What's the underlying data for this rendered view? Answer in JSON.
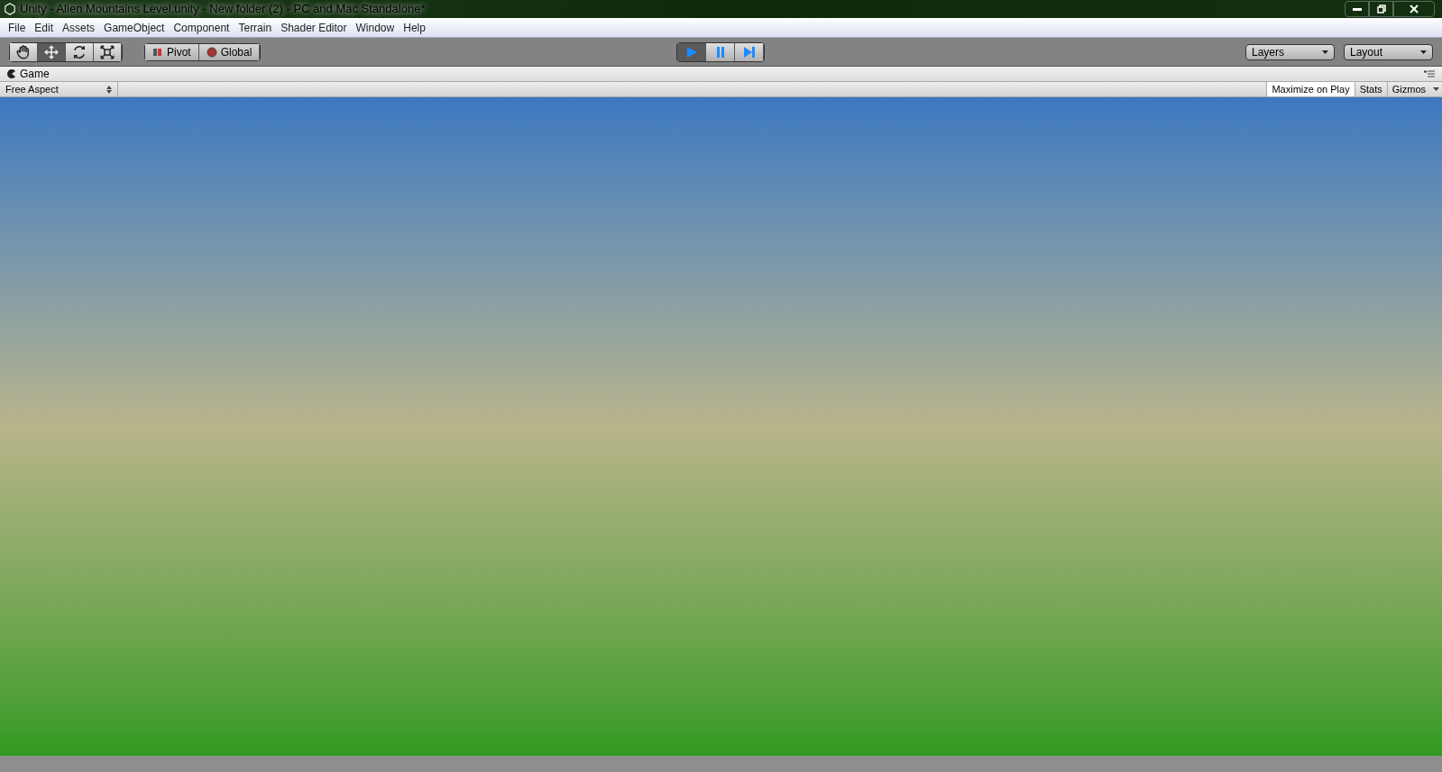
{
  "window": {
    "title": "Unity - Alien Mountains Level.unity - New folder (2) - PC and Mac Standalone*"
  },
  "menu": [
    "File",
    "Edit",
    "Assets",
    "GameObject",
    "Component",
    "Terrain",
    "Shader Editor",
    "Window",
    "Help"
  ],
  "tools": [
    {
      "kind": "hand",
      "selected": false
    },
    {
      "kind": "move",
      "selected": true
    },
    {
      "kind": "rotate",
      "selected": false
    },
    {
      "kind": "scale",
      "selected": false
    }
  ],
  "pivot_buttons": [
    {
      "kind": "pivot",
      "label": "Pivot"
    },
    {
      "kind": "global",
      "label": "Global"
    }
  ],
  "playback": [
    {
      "kind": "play",
      "selected": true
    },
    {
      "kind": "pause",
      "selected": false
    },
    {
      "kind": "step",
      "selected": false
    }
  ],
  "dropdowns": [
    "Layers",
    "Layout"
  ],
  "game_tab": {
    "label": "Game"
  },
  "game_toolbar": {
    "aspect": "Free Aspect",
    "buttons": [
      {
        "label": "Maximize on Play",
        "selected": true
      },
      {
        "label": "Stats",
        "selected": false
      },
      {
        "label": "Gizmos",
        "selected": false
      }
    ]
  }
}
